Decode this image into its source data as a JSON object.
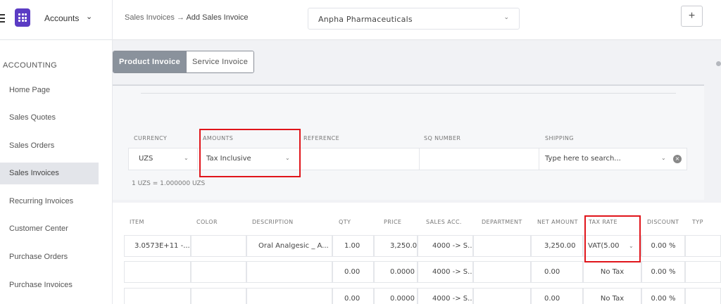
{
  "header": {
    "app_label": "Accounts",
    "breadcrumb_parent": "Sales Invoices",
    "breadcrumb_sep": "→",
    "breadcrumb_current": "Add Sales Invoice",
    "company": "Anpha Pharmaceuticals",
    "add_label": "+"
  },
  "sidebar": {
    "section": "ACCOUNTING",
    "items": [
      {
        "label": "Home Page"
      },
      {
        "label": "Sales Quotes"
      },
      {
        "label": "Sales Orders"
      },
      {
        "label": "Sales Invoices",
        "active": true
      },
      {
        "label": "Recurring Invoices"
      },
      {
        "label": "Customer Center"
      },
      {
        "label": "Purchase Orders"
      },
      {
        "label": "Purchase Invoices"
      }
    ]
  },
  "tabs": [
    {
      "label": "Product Invoice",
      "active": true
    },
    {
      "label": "Service Invoice",
      "active": false
    }
  ],
  "form": {
    "labels": {
      "currency": "CURRENCY",
      "amounts": "AMOUNTS",
      "reference": "REFERENCE",
      "sq_number": "SQ NUMBER",
      "shipping": "SHIPPING"
    },
    "currency_value": "UZS",
    "amounts_value": "Tax Inclusive",
    "reference_value": "",
    "sq_number_value": "",
    "shipping_placeholder": "Type here to search...",
    "rate_note": "1 UZS = 1.000000 UZS"
  },
  "table": {
    "headers": [
      "ITEM",
      "COLOR",
      "DESCRIPTION",
      "QTY",
      "PRICE",
      "SALES ACC.",
      "DEPARTMENT",
      "NET AMOUNT",
      "TAX RATE",
      "DISCOUNT",
      "TYP"
    ],
    "rows": [
      {
        "item": "3.0573E+11 -...",
        "color": "",
        "description": "Oral Analgesic _ A...",
        "qty": "1.00",
        "price": "3,250.0",
        "sales_acc": "4000 -> S...",
        "department": "",
        "net_amount": "3,250.00",
        "tax_rate": "VAT(5.00",
        "discount": "0.00 %"
      },
      {
        "item": "",
        "color": "",
        "description": "",
        "qty": "0.00",
        "price": "0.0000",
        "sales_acc": "4000 -> S...",
        "department": "",
        "net_amount": "0.00",
        "tax_rate": "No Tax",
        "discount": "0.00 %"
      },
      {
        "item": "",
        "color": "",
        "description": "",
        "qty": "0.00",
        "price": "0.0000",
        "sales_acc": "4000 -> S...",
        "department": "",
        "net_amount": "0.00",
        "tax_rate": "No Tax",
        "discount": "0.00 %"
      }
    ]
  },
  "colors": {
    "brand": "#5b3cc4",
    "highlight": "#e0151b",
    "active_tab": "#8a929c"
  },
  "icons": [
    "hamburger-icon",
    "app-logo-icon",
    "chevron-down-icon",
    "clear-icon"
  ]
}
